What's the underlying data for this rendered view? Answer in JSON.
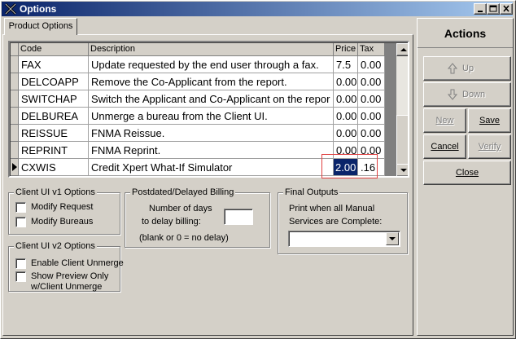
{
  "window": {
    "title": "Options"
  },
  "tabs": [
    {
      "label": "Product Options"
    }
  ],
  "grid": {
    "columns": [
      "Code",
      "Description",
      "Price",
      "Tax"
    ],
    "rows": [
      {
        "code": "FAX",
        "description": "Update requested by the end user through a fax.",
        "price": "7.5",
        "tax": "0.00"
      },
      {
        "code": "DELCOAPP",
        "description": "Remove the Co-Applicant from the report.",
        "price": "0.00",
        "tax": "0.00"
      },
      {
        "code": "SWITCHAP",
        "description": "Switch the Applicant and Co-Applicant on the repor",
        "price": "0.00",
        "tax": "0.00"
      },
      {
        "code": "DELBUREA",
        "description": "Unmerge a bureau from the Client UI.",
        "price": "0.00",
        "tax": "0.00"
      },
      {
        "code": "REISSUE",
        "description": "FNMA Reissue.",
        "price": "0.00",
        "tax": "0.00"
      },
      {
        "code": "REPRINT",
        "description": "FNMA Reprint.",
        "price": "0.00",
        "tax": "0.00"
      },
      {
        "code": "CXWIS",
        "description": "Credit Xpert What-If Simulator",
        "price": "2.00",
        "tax": ".16"
      }
    ]
  },
  "client_ui_v1": {
    "title": "Client UI v1 Options",
    "modify_requests": "Modify Request",
    "modify_bureaus": "Modify Bureaus"
  },
  "billing": {
    "title": "Postdated/Delayed Billing",
    "days_label_1": "Number of days",
    "days_label_2": "to delay billing:",
    "days_value": "",
    "note": "(blank or 0 = no delay)"
  },
  "final_outputs": {
    "title": "Final Outputs",
    "label_1": "Print when all Manual",
    "label_2": "Services are Complete:",
    "selected": ""
  },
  "client_ui_v2": {
    "title": "Client UI v2 Options",
    "enable_unmerge": "Enable Client Unmerge",
    "show_preview_1": "Show Preview Only",
    "show_preview_2": "w/Client Unmerge"
  },
  "actions": {
    "title": "Actions",
    "up": "Up",
    "down": "Down",
    "new": "New",
    "save": "Save",
    "cancel": "Cancel",
    "verify": "Verify",
    "close": "Close"
  }
}
